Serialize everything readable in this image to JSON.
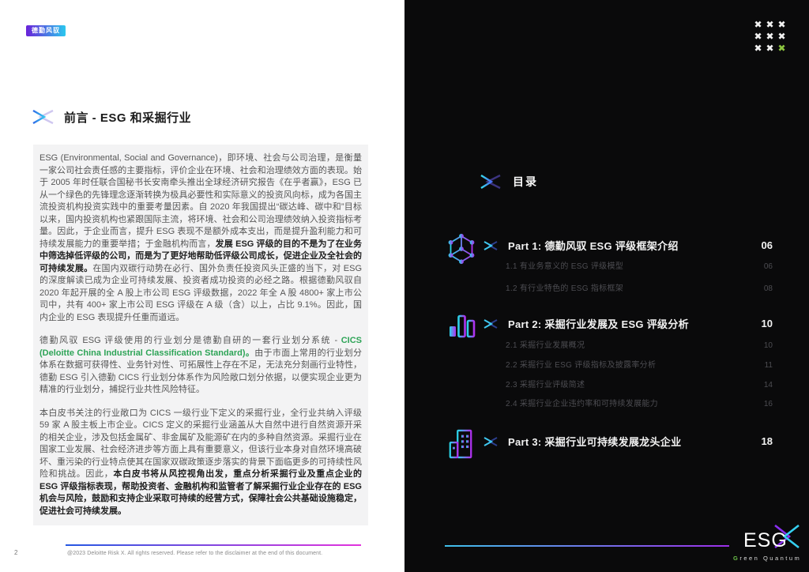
{
  "brand": {
    "badge_label": "德勤风驭",
    "grid_glyph": "✖",
    "logo_esg": "ESG",
    "logo_green_initial": "G",
    "logo_green_rest": "reen",
    "logo_quantum": "Quantum"
  },
  "preface": {
    "title": "前言 - ESG 和采掘行业",
    "p1_a": "ESG (Environmental, Social and Governance)，即环境、社会与公司治理，是衡量一家公司社会责任感的主要指标，评价企业在环境、社会和治理绩效方面的表现。始于 2005 年时任联合国秘书长安南牵头推出全球经济研究报告《在乎者赢》，ESG 已从一个绿色的先锋理念逐渐转换为极具必要性和实际意义的投资风向标，成为各国主流投资机构投资实践中的重要考量因素。自 2020 年我国提出“碳达峰、碳中和”目标以来，国内投资机构也紧跟国际主流，将环境、社会和公司治理绩效纳入投资指标考量。因此，于企业而言，提升 ESG 表现不是额外成本支出，而是提升盈利能力和可持续发展能力的重要举措；于金融机构而言，",
    "p1_bold": "发展 ESG 评级的目的不是为了在业务中筛选掉低评级的公司，而是为了更好地帮助低评级公司成长，促进企业及全社会的可持续发展。",
    "p1_b": "在国内双碳行动势在必行、国外负责任投资风头正盛的当下，对 ESG 的深度解读已成为企业可持续发展、投资者成功投资的必经之路。根据德勤风驭自 2020 年起开展的全 A 股上市公司 ESG 评级数据，2022 年全 A 股 4800+ 家上市公司中，共有 400+ 家上市公司 ESG 评级在 A 级（含）以上，占比 9.1%。因此，国内企业的 ESG 表现提升任重而道远。",
    "p2_a": "德勤风驭 ESG 评级使用的行业划分是德勤自研的一套行业划分系统 - ",
    "p2_cics": "CICS (Deloitte China Industrial Classification Standard)。",
    "p2_b": "由于市面上常用的行业划分体系在数据可获得性、业务针对性、可拓展性上存在不足，无法充分刻画行业特性，德勤 ESG 引入德勤 CICS 行业划分体系作为风险敞口划分依据，以便实现企业更为精准的行业划分，捕捉行业共性风险特征。",
    "p3_a": "本白皮书关注的行业敞口为 CICS 一级行业下定义的采掘行业，全行业共纳入评级 59 家 A 股主板上市企业。CICS 定义的采掘行业涵盖从大自然中进行自然资源开采的相关企业，涉及包括金属矿、非金属矿及能源矿在内的多种自然资源。采掘行业在国家工业发展、社会经济进步等方面上具有重要意义，但该行业本身对自然环境高破坏、重污染的行业特点使其在国家双碳政策逐步落实的背景下面临更多的可持续性风险和挑战。因此，",
    "p3_bold": "本白皮书将从风控视角出发，重点分析采掘行业及重点企业的 ESG 评级指标表现，帮助投资者、金融机构和监管者了解采掘行业企业存在的 ESG 机会与风险，鼓励和支持企业采取可持续的经营方式，保障社会公共基础设施稳定，促进社会可持续发展。"
  },
  "toc": {
    "heading": "目录",
    "sections": [
      {
        "title": "Part 1: 德勤风驭 ESG 评级框架介绍",
        "page": "06",
        "items": [
          {
            "label": "1.1 有业务意义的 ESG 评级模型",
            "page": "06"
          },
          {
            "label": "1.2 有行业特色的 ESG 指标框架",
            "page": "08"
          }
        ]
      },
      {
        "title": "Part 2: 采掘行业发展及 ESG 评级分析",
        "page": "10",
        "items": [
          {
            "label": "2.1 采掘行业发展概况",
            "page": "10"
          },
          {
            "label": "2.2 采掘行业 ESG 评级指标及披露率分析",
            "page": "11"
          },
          {
            "label": "2.3 采掘行业评级简述",
            "page": "14"
          },
          {
            "label": "2.4 采掘行业企业违约率和可持续发展能力",
            "page": "16"
          }
        ]
      },
      {
        "title": "Part 3: 采掘行业可持续发展龙头企业",
        "page": "18",
        "items": []
      }
    ]
  },
  "footer": {
    "page_number": "2",
    "note": "@2023 Deloitte Risk X. All rights reserved. Please refer to the disclaimer at the end of this document."
  },
  "colors": {
    "accent_cyan": "#3FC0EA",
    "accent_purple": "#9C2FE8",
    "cics_green": "#2EA457",
    "grid_green": "#8DC63F",
    "badge_gradient_start": "#6A22D9",
    "badge_gradient_end": "#2BC8EE",
    "line_left_gradient": "#2558E2 → #E233DD",
    "line_right_gradient": "#3FC0EA → #9C2FE8",
    "dark_background": "#0A0A0B",
    "panel_background": "#F3F3F4"
  }
}
